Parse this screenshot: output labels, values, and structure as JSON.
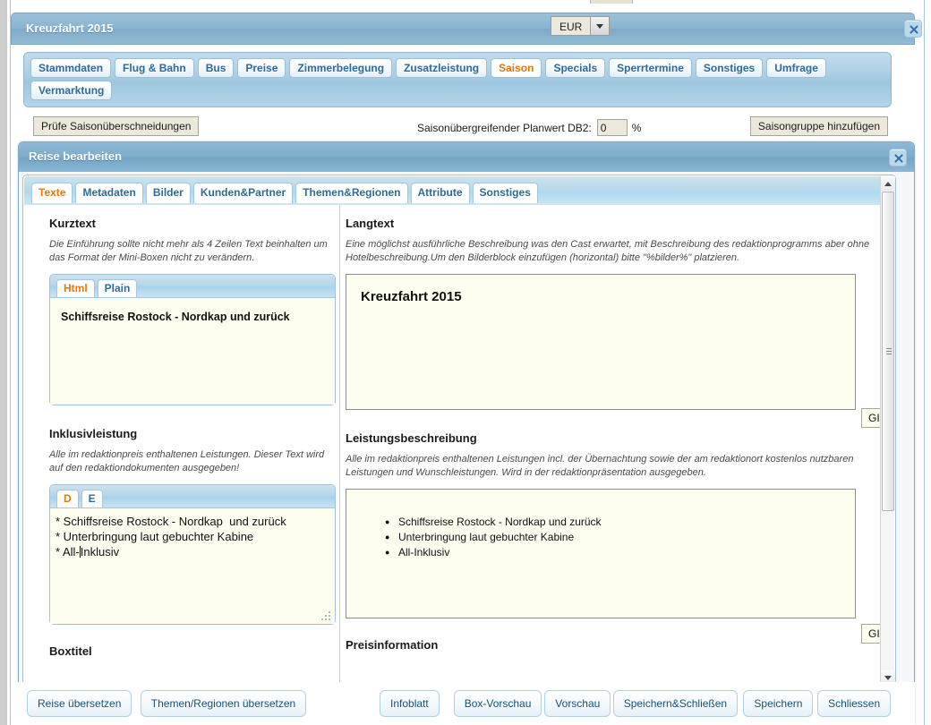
{
  "window": {
    "title": "Kreuzfahrt 2015",
    "close_icon": "close-icon",
    "currency": {
      "value": "EUR",
      "arrow_icon": "chevron-down-icon"
    }
  },
  "main_tabs": [
    {
      "label": "Stammdaten",
      "active": false
    },
    {
      "label": "Flug & Bahn",
      "active": false
    },
    {
      "label": "Bus",
      "active": false
    },
    {
      "label": "Preise",
      "active": false
    },
    {
      "label": "Zimmerbelegung",
      "active": false
    },
    {
      "label": "Zusatzleistung",
      "active": false
    },
    {
      "label": "Saison",
      "active": true
    },
    {
      "label": "Specials",
      "active": false
    },
    {
      "label": "Sperrtermine",
      "active": false
    },
    {
      "label": "Sonstiges",
      "active": false
    },
    {
      "label": "Umfrage",
      "active": false
    },
    {
      "label": "Vermarktung",
      "active": false
    }
  ],
  "toolbar": {
    "check_overlaps_label": "Prüfe Saisonüberschneidungen",
    "planwert_label": "Saisonübergreifender Planwert DB2:",
    "planwert_value": "0",
    "percent_sign": "%",
    "add_group_label": "Saisongruppe hinzufügen"
  },
  "modal": {
    "title": "Reise bearbeiten",
    "close_icon": "close-icon",
    "tabs": [
      {
        "label": "Texte",
        "active": true
      },
      {
        "label": "Metadaten",
        "active": false
      },
      {
        "label": "Bilder",
        "active": false
      },
      {
        "label": "Kunden&Partner",
        "active": false
      },
      {
        "label": "Themen&Regionen",
        "active": false
      },
      {
        "label": "Attribute",
        "active": false
      },
      {
        "label": "Sonstiges",
        "active": false
      }
    ],
    "kurztext": {
      "title": "Kurztext",
      "hint": "Die Einführung sollte nicht mehr als 4 Zeilen Text beinhalten um das Format der Mini-Boxen nicht zu verändern.",
      "editor_tabs": [
        {
          "label": "Html",
          "active": true
        },
        {
          "label": "Plain",
          "active": false
        }
      ],
      "content": "Schiffsreise Rostock - Nordkap und zurück"
    },
    "langtext": {
      "title": "Langtext",
      "hint": "Eine möglichst ausführliche Beschreibung was den Cast erwartet, mit Beschreibung des redaktionprogramms aber ohne Hotelbeschreibung.Um den Bilderblock einzufügen (horizontal) bitte \"%bilder%\" platzieren.",
      "content_heading": "Kreuzfahrt 2015",
      "giata_label": "GIATA"
    },
    "inklusivleistung": {
      "title": "Inklusivleistung",
      "hint": "Alle im redaktionpreis enthaltenen Leistungen. Dieser Text wird auf den redaktiondokumenten ausgegeben!",
      "lang_tabs": [
        {
          "label": "D",
          "active": true
        },
        {
          "label": "E",
          "active": false
        }
      ],
      "line1": "* Schiffsreise Rostock - Nordkap  und zurück",
      "line2": "* Unterbringung laut gebuchter Kabine",
      "line3_before_caret": "* All-",
      "line3_after_caret": "Inklusiv",
      "resize_grip_icon": "resize-grip-icon"
    },
    "leistungsbeschreibung": {
      "title": "Leistungsbeschreibung",
      "hint": "Alle im redaktionpreis enthaltenen Leistungen incl. der Übernachtung sowie der am redaktionort kostenlos nutzbaren Leistungen und Wunschleistungen. Wird in der redaktionpräsentation ausgegeben.",
      "bullets": [
        "Schiffsreise Rostock - Nordkap  und zurück",
        "Unterbringung laut gebuchter Kabine",
        "All-Inklusiv"
      ],
      "giata_label": "GIATA"
    },
    "boxtitel_label": "Boxtitel",
    "preisinformation_label": "Preisinformation",
    "scrollbars": {
      "v_up_icon": "triangle-up-icon",
      "v_down_icon": "triangle-down-icon",
      "h_left_icon": "triangle-left-icon",
      "h_right_icon": "triangle-right-icon"
    }
  },
  "footer": {
    "left_buttons": [
      {
        "label": "Reise übersetzen"
      },
      {
        "label": "Themen/Regionen übersetzen"
      }
    ],
    "right_buttons": [
      {
        "label": "Infoblatt"
      },
      {
        "label": "Box-Vorschau"
      },
      {
        "label": "Vorschau"
      },
      {
        "label": "Speichern&Schließen"
      },
      {
        "label": "Speichern"
      },
      {
        "label": "Schliessen"
      }
    ]
  },
  "colors": {
    "accent_orange": "#e8770d",
    "tab_blue": "#2f6a99",
    "titlebar_blue": "#8ab4d0",
    "field_cream": "#fdfdf0"
  }
}
